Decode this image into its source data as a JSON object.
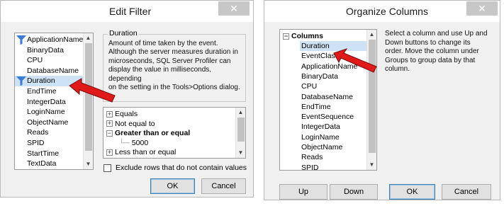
{
  "edit_filter": {
    "title": "Edit Filter",
    "close_glyph": "✕",
    "columns": [
      {
        "label": "ApplicationName",
        "has_filter": true,
        "selected": false
      },
      {
        "label": "BinaryData",
        "has_filter": false,
        "selected": false
      },
      {
        "label": "CPU",
        "has_filter": false,
        "selected": false
      },
      {
        "label": "DatabaseName",
        "has_filter": false,
        "selected": false
      },
      {
        "label": "Duration",
        "has_filter": true,
        "selected": true
      },
      {
        "label": "EndTime",
        "has_filter": false,
        "selected": false
      },
      {
        "label": "IntegerData",
        "has_filter": false,
        "selected": false
      },
      {
        "label": "LoginName",
        "has_filter": false,
        "selected": false
      },
      {
        "label": "ObjectName",
        "has_filter": false,
        "selected": false
      },
      {
        "label": "Reads",
        "has_filter": false,
        "selected": false
      },
      {
        "label": "SPID",
        "has_filter": false,
        "selected": false
      },
      {
        "label": "StartTime",
        "has_filter": false,
        "selected": false
      },
      {
        "label": "TextData",
        "has_filter": false,
        "selected": false
      }
    ],
    "description_title": "Duration",
    "description_lines": [
      "Amount of time taken by the event.",
      "Although the server measures duration in",
      "microseconds, SQL Server Profiler can",
      "display the value in milliseconds, depending",
      "on the setting in the Tools>Options dialog."
    ],
    "operators": [
      {
        "label": "Equals",
        "toggle": "+",
        "bold": false,
        "value": false
      },
      {
        "label": "Not equal to",
        "toggle": "+",
        "bold": false,
        "value": false
      },
      {
        "label": "Greater than or equal",
        "toggle": "−",
        "bold": true,
        "value": false
      },
      {
        "label": "5000",
        "toggle": "",
        "bold": false,
        "value": true
      },
      {
        "label": "Less than or equal",
        "toggle": "+",
        "bold": false,
        "value": false
      }
    ],
    "exclude_label": "Exclude rows that do not contain values",
    "ok_label": "OK",
    "cancel_label": "Cancel"
  },
  "organize_columns": {
    "title": "Organize Columns",
    "close_glyph": "✕",
    "root_label": "Columns",
    "root_toggle": "−",
    "columns": [
      "Duration",
      "EventClass",
      "ApplicationName",
      "BinaryData",
      "CPU",
      "DatabaseName",
      "EndTime",
      "EventSequence",
      "IntegerData",
      "LoginName",
      "ObjectName",
      "Reads",
      "SPID"
    ],
    "instructions": [
      "Select a column and use Up and",
      "Down buttons to change its",
      "order. Move the column under",
      "Groups to group data by that",
      "column."
    ],
    "up_label": "Up",
    "down_label": "Down",
    "ok_label": "OK",
    "cancel_label": "Cancel"
  },
  "colors": {
    "selection": "#cde3f5",
    "filter_icon": "#3a7bd5",
    "annotation_arrow": "#e01919"
  },
  "icons": {
    "filter": "funnel-icon",
    "close": "close-icon",
    "scroll_up": "scroll-up-arrow-icon",
    "scroll_down": "scroll-down-arrow-icon",
    "annotation": "red-arrow-icon"
  }
}
